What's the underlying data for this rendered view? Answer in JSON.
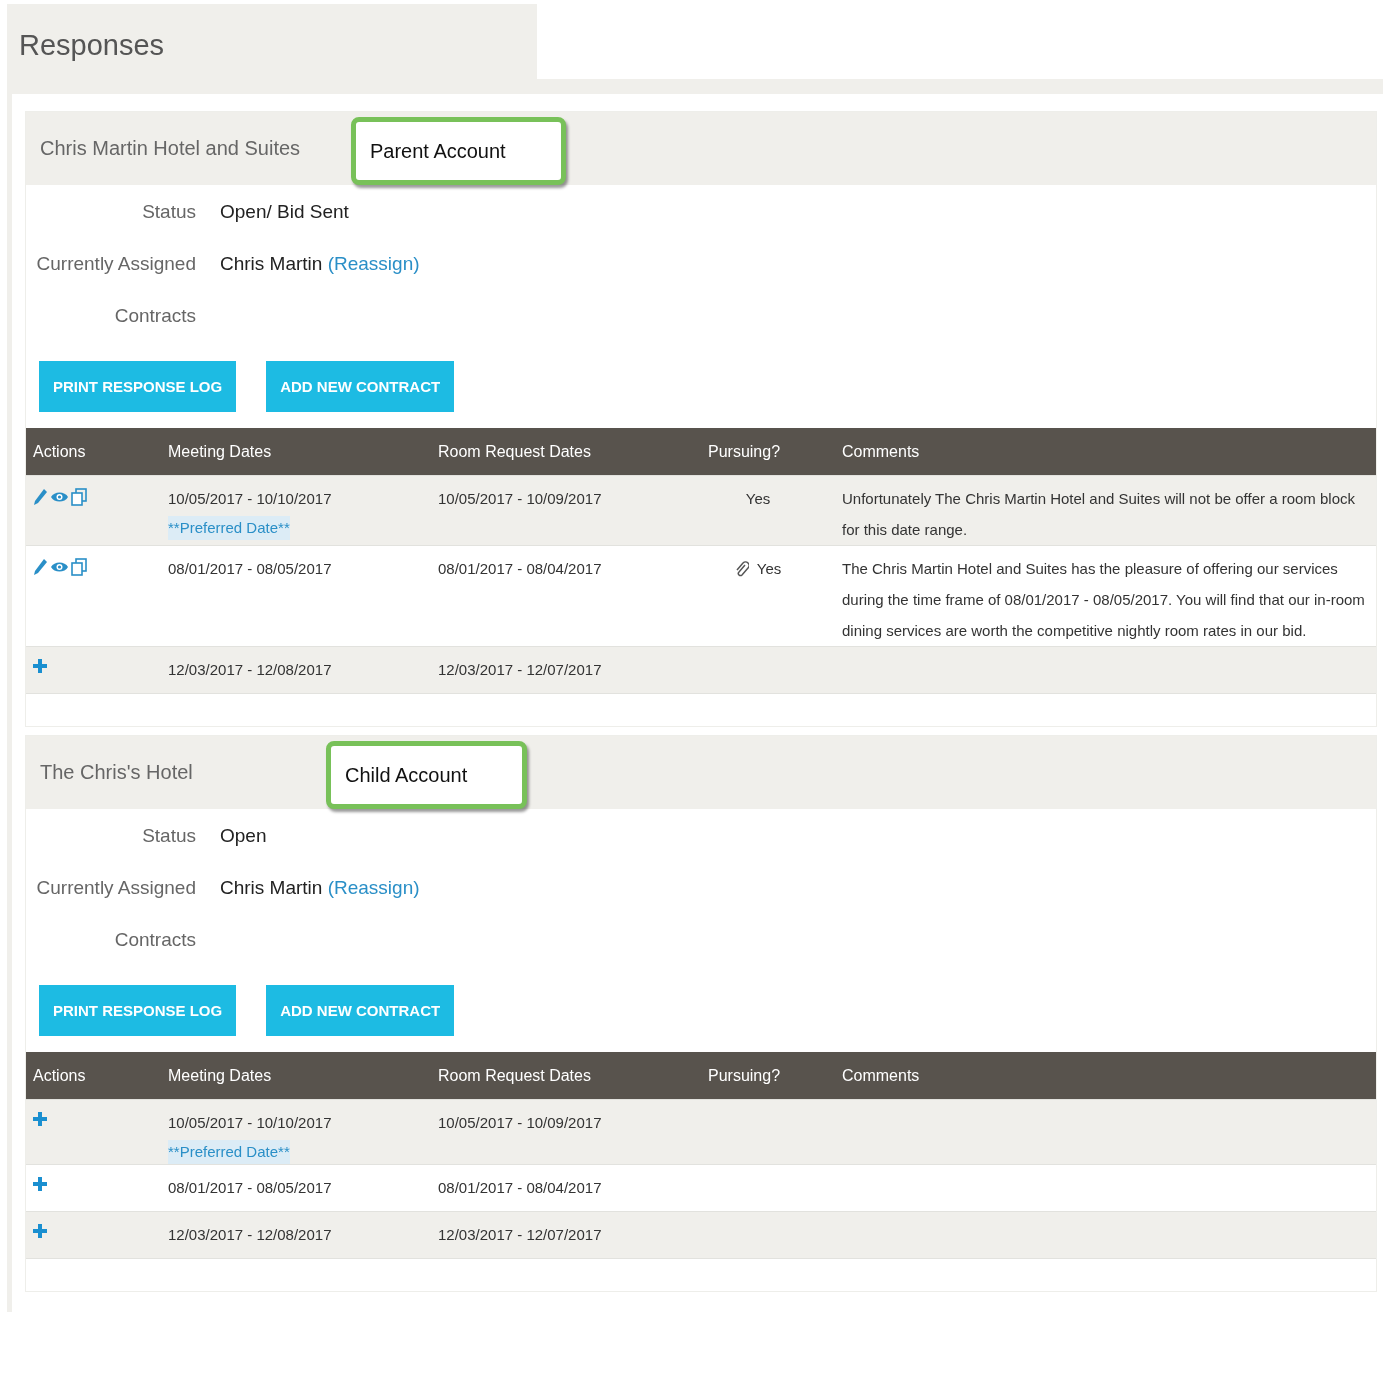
{
  "page_title": "Responses",
  "sections": [
    {
      "columns": [
        "Actions",
        "Meeting Dates",
        "Room Request Dates",
        "Pursuing?",
        "Comments"
      ],
      "hotel": "Chris Martin Hotel and Suites",
      "badge": "Parent Account",
      "fields": [
        {
          "label": "Status",
          "value": "Open/ Bid Sent"
        },
        {
          "label": "Currently Assigned",
          "value": "Chris Martin",
          "link": "(Reassign)"
        },
        {
          "label": "Contracts"
        }
      ],
      "buttons": [
        "PRINT RESPONSE LOG",
        "ADD NEW CONTRACT"
      ],
      "rows": [
        {
          "kind": "edit",
          "meeting": "10/05/2017 - 10/10/2017",
          "preferred": "**Preferred Date**",
          "room": "10/05/2017 - 10/09/2017",
          "pursuing": "Yes",
          "attachment": false,
          "comment": "Unfortunately The Chris Martin Hotel and Suites will not be offer a room block for this date range."
        },
        {
          "kind": "edit",
          "meeting": "08/01/2017 - 08/05/2017",
          "room": "08/01/2017 - 08/04/2017",
          "pursuing": "Yes",
          "attachment": true,
          "comment": "The Chris Martin Hotel and Suites has the pleasure of offering our services during the time frame of 08/01/2017 - 08/05/2017. You will find that our in-room dining services are worth the competitive nightly room rates in our bid."
        },
        {
          "kind": "add",
          "meeting": "12/03/2017 - 12/08/2017",
          "room": "12/03/2017 - 12/07/2017"
        }
      ]
    },
    {
      "columns": [
        "Actions",
        "Meeting Dates",
        "Room Request Dates",
        "Pursuing?",
        "Comments"
      ],
      "hotel": "The Chris's Hotel",
      "badge": "Child Account",
      "fields": [
        {
          "label": "Status",
          "value": "Open"
        },
        {
          "label": "Currently Assigned",
          "value": "Chris Martin",
          "link": "(Reassign)"
        },
        {
          "label": "Contracts"
        }
      ],
      "buttons": [
        "PRINT RESPONSE LOG",
        "ADD NEW CONTRACT"
      ],
      "rows": [
        {
          "kind": "add",
          "meeting": "10/05/2017 - 10/10/2017",
          "preferred": "**Preferred Date**",
          "room": "10/05/2017 - 10/09/2017"
        },
        {
          "kind": "add",
          "meeting": "08/01/2017 - 08/05/2017",
          "room": "08/01/2017 - 08/04/2017"
        },
        {
          "kind": "add",
          "meeting": "12/03/2017 - 12/08/2017",
          "room": "12/03/2017 - 12/07/2017"
        }
      ]
    }
  ]
}
